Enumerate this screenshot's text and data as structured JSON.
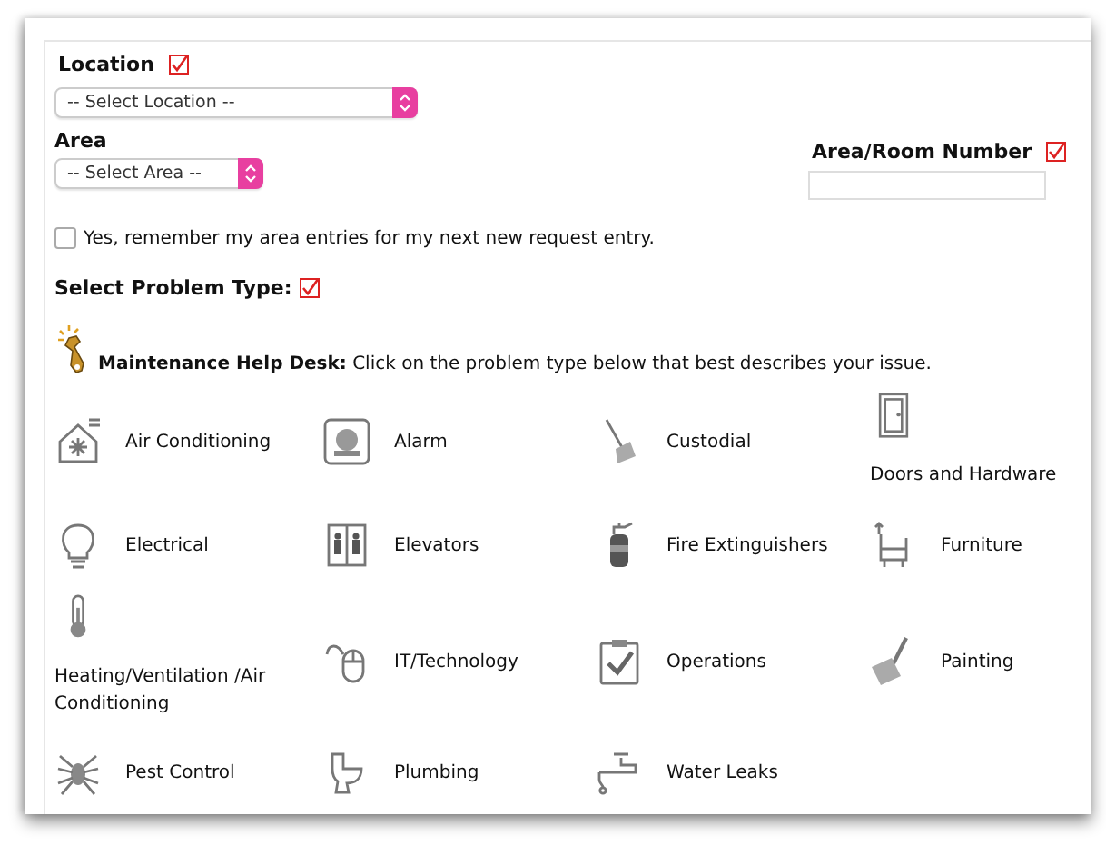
{
  "location": {
    "label": "Location",
    "select": "-- Select Location --"
  },
  "area": {
    "label": "Area",
    "select": "-- Select Area --"
  },
  "room": {
    "label": "Area/Room Number"
  },
  "remember": {
    "label": "Yes, remember my area entries for my next new request entry.",
    "checked": false
  },
  "problem_type": {
    "label": "Select Problem Type:"
  },
  "help_desk": {
    "text": "**Maintenance Help Desk:** Click on the problem type below that best describes your issue."
  },
  "problems": [
    {
      "label": "Air Conditioning",
      "kind": "inline"
    },
    {
      "label": "Alarm",
      "kind": "inline"
    },
    {
      "label": "Custodial",
      "kind": "inline"
    },
    {
      "label": "Doors and Hardware",
      "kind": "stacked"
    },
    {
      "label": "Electrical",
      "kind": "inline"
    },
    {
      "label": "Elevators",
      "kind": "inline"
    },
    {
      "label": "Fire Extinguishers",
      "kind": "inline"
    },
    {
      "label": "Furniture",
      "kind": "inline"
    },
    {
      "label": "Heating/Ventilation /Air Conditioning",
      "kind": "stacked"
    },
    {
      "label": "IT/Technology",
      "kind": "inline"
    },
    {
      "label": "Operations",
      "kind": "inline"
    },
    {
      "label": "Painting",
      "kind": "inline"
    },
    {
      "label": "Pest Control",
      "kind": "inline"
    },
    {
      "label": "Plumbing",
      "kind": "inline"
    },
    {
      "label": "Water Leaks",
      "kind": "inline"
    }
  ]
}
